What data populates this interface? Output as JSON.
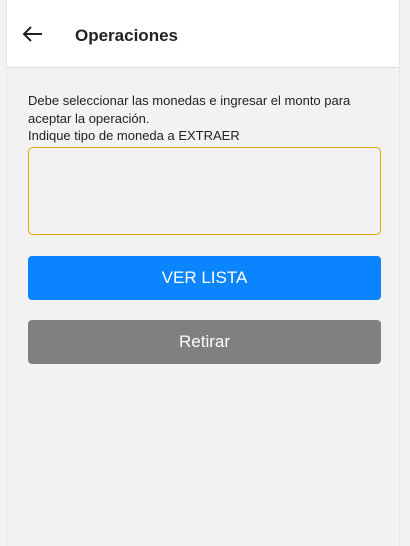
{
  "header": {
    "title": "Operaciones",
    "back_icon": "arrow-left-icon"
  },
  "form": {
    "instruction_line1": "Debe seleccionar las monedas e ingresar el monto para",
    "instruction_line2": "aceptar la operación.",
    "instruction_line3": "Indique tipo de moneda a EXTRAER",
    "amount_value": ""
  },
  "buttons": {
    "list_label": "VER LISTA",
    "withdraw_label": "Retirar"
  },
  "colors": {
    "primary": "#0a84ff",
    "disabled": "#808080",
    "input_focus": "#e0a800"
  }
}
